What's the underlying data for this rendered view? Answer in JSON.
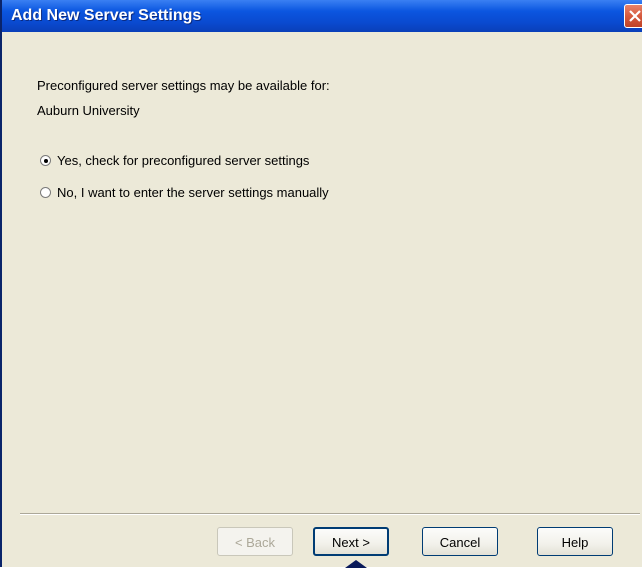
{
  "window": {
    "title": "Add New Server Settings"
  },
  "content": {
    "intro_line1": "Preconfigured server settings may be available for:",
    "intro_line2": "Auburn University",
    "options": [
      {
        "label": "Yes, check for preconfigured server settings",
        "selected": true
      },
      {
        "label": "No, I want to enter the server settings manually",
        "selected": false
      }
    ]
  },
  "buttons": {
    "back": "< Back",
    "next": "Next >",
    "cancel": "Cancel",
    "help": "Help"
  },
  "colors": {
    "titlebar": "#0a4ad0",
    "dialog_bg": "#ece9d8",
    "close_button": "#d65a3e"
  },
  "icons": {
    "close": "close-icon",
    "cursor": "arrow-cursor-icon"
  }
}
